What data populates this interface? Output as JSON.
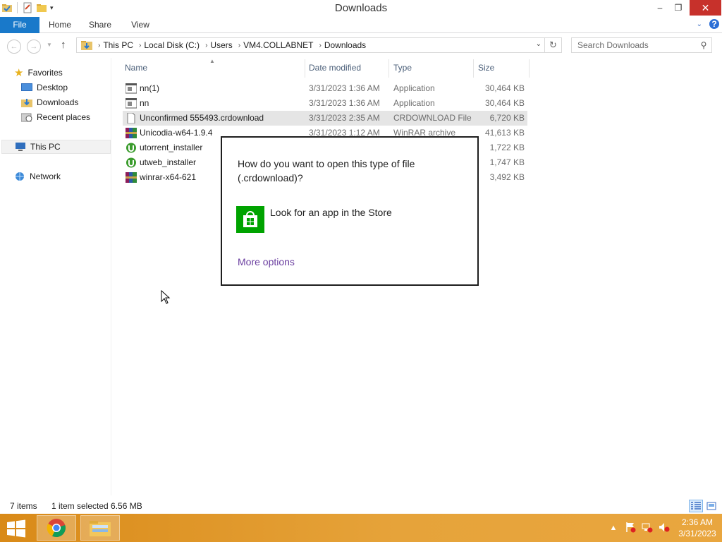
{
  "window": {
    "title": "Downloads",
    "minimize_glyph": "–",
    "restore_glyph": "❐",
    "close_glyph": "✕"
  },
  "ribbon": {
    "tabs": [
      "File",
      "Home",
      "Share",
      "View"
    ]
  },
  "address": {
    "crumbs": [
      "This PC",
      "Local Disk (C:)",
      "Users",
      "VM4.COLLABNET",
      "Downloads"
    ]
  },
  "search": {
    "placeholder": "Search Downloads"
  },
  "nav": {
    "favorites_label": "Favorites",
    "favorites": [
      "Desktop",
      "Downloads",
      "Recent places"
    ],
    "this_pc_label": "This PC",
    "network_label": "Network"
  },
  "columns": {
    "name": "Name",
    "date": "Date modified",
    "type": "Type",
    "size": "Size"
  },
  "files": [
    {
      "name": "nn(1)",
      "date": "3/31/2023 1:36 AM",
      "type": "Application",
      "size": "30,464 KB",
      "icon": "application-icon"
    },
    {
      "name": "nn",
      "date": "3/31/2023 1:36 AM",
      "type": "Application",
      "size": "30,464 KB",
      "icon": "application-icon"
    },
    {
      "name": "Unconfirmed 555493.crdownload",
      "date": "3/31/2023 2:35 AM",
      "type": "CRDOWNLOAD File",
      "size": "6,720 KB",
      "icon": "blank-file-icon"
    },
    {
      "name": "Unicodia-w64-1.9.4",
      "date": "3/31/2023 1:12 AM",
      "type": "WinRAR archive",
      "size": "41,613 KB",
      "icon": "winrar-icon"
    },
    {
      "name": "utorrent_installer",
      "date": "",
      "type": "",
      "size": "1,722 KB",
      "icon": "utorrent-icon"
    },
    {
      "name": "utweb_installer",
      "date": "",
      "type": "",
      "size": "1,747 KB",
      "icon": "utorrent-icon"
    },
    {
      "name": "winrar-x64-621",
      "date": "",
      "type": "",
      "size": "3,492 KB",
      "icon": "winrar-icon"
    }
  ],
  "dialog": {
    "question": "How do you want to open this type of file (.crdownload)?",
    "store_option": "Look for an app in the Store",
    "more_options": "More options"
  },
  "status": {
    "item_count": "7 items",
    "selection": "1 item selected  6.56 MB"
  },
  "taskbar": {
    "time": "2:36 AM",
    "date": "3/31/2023"
  },
  "colors": {
    "file_tab": "#1979ca",
    "store_green": "#00a300",
    "taskbar": "#e09a2c",
    "close_button": "#c7312b",
    "link_purple": "#6b3fa0"
  }
}
